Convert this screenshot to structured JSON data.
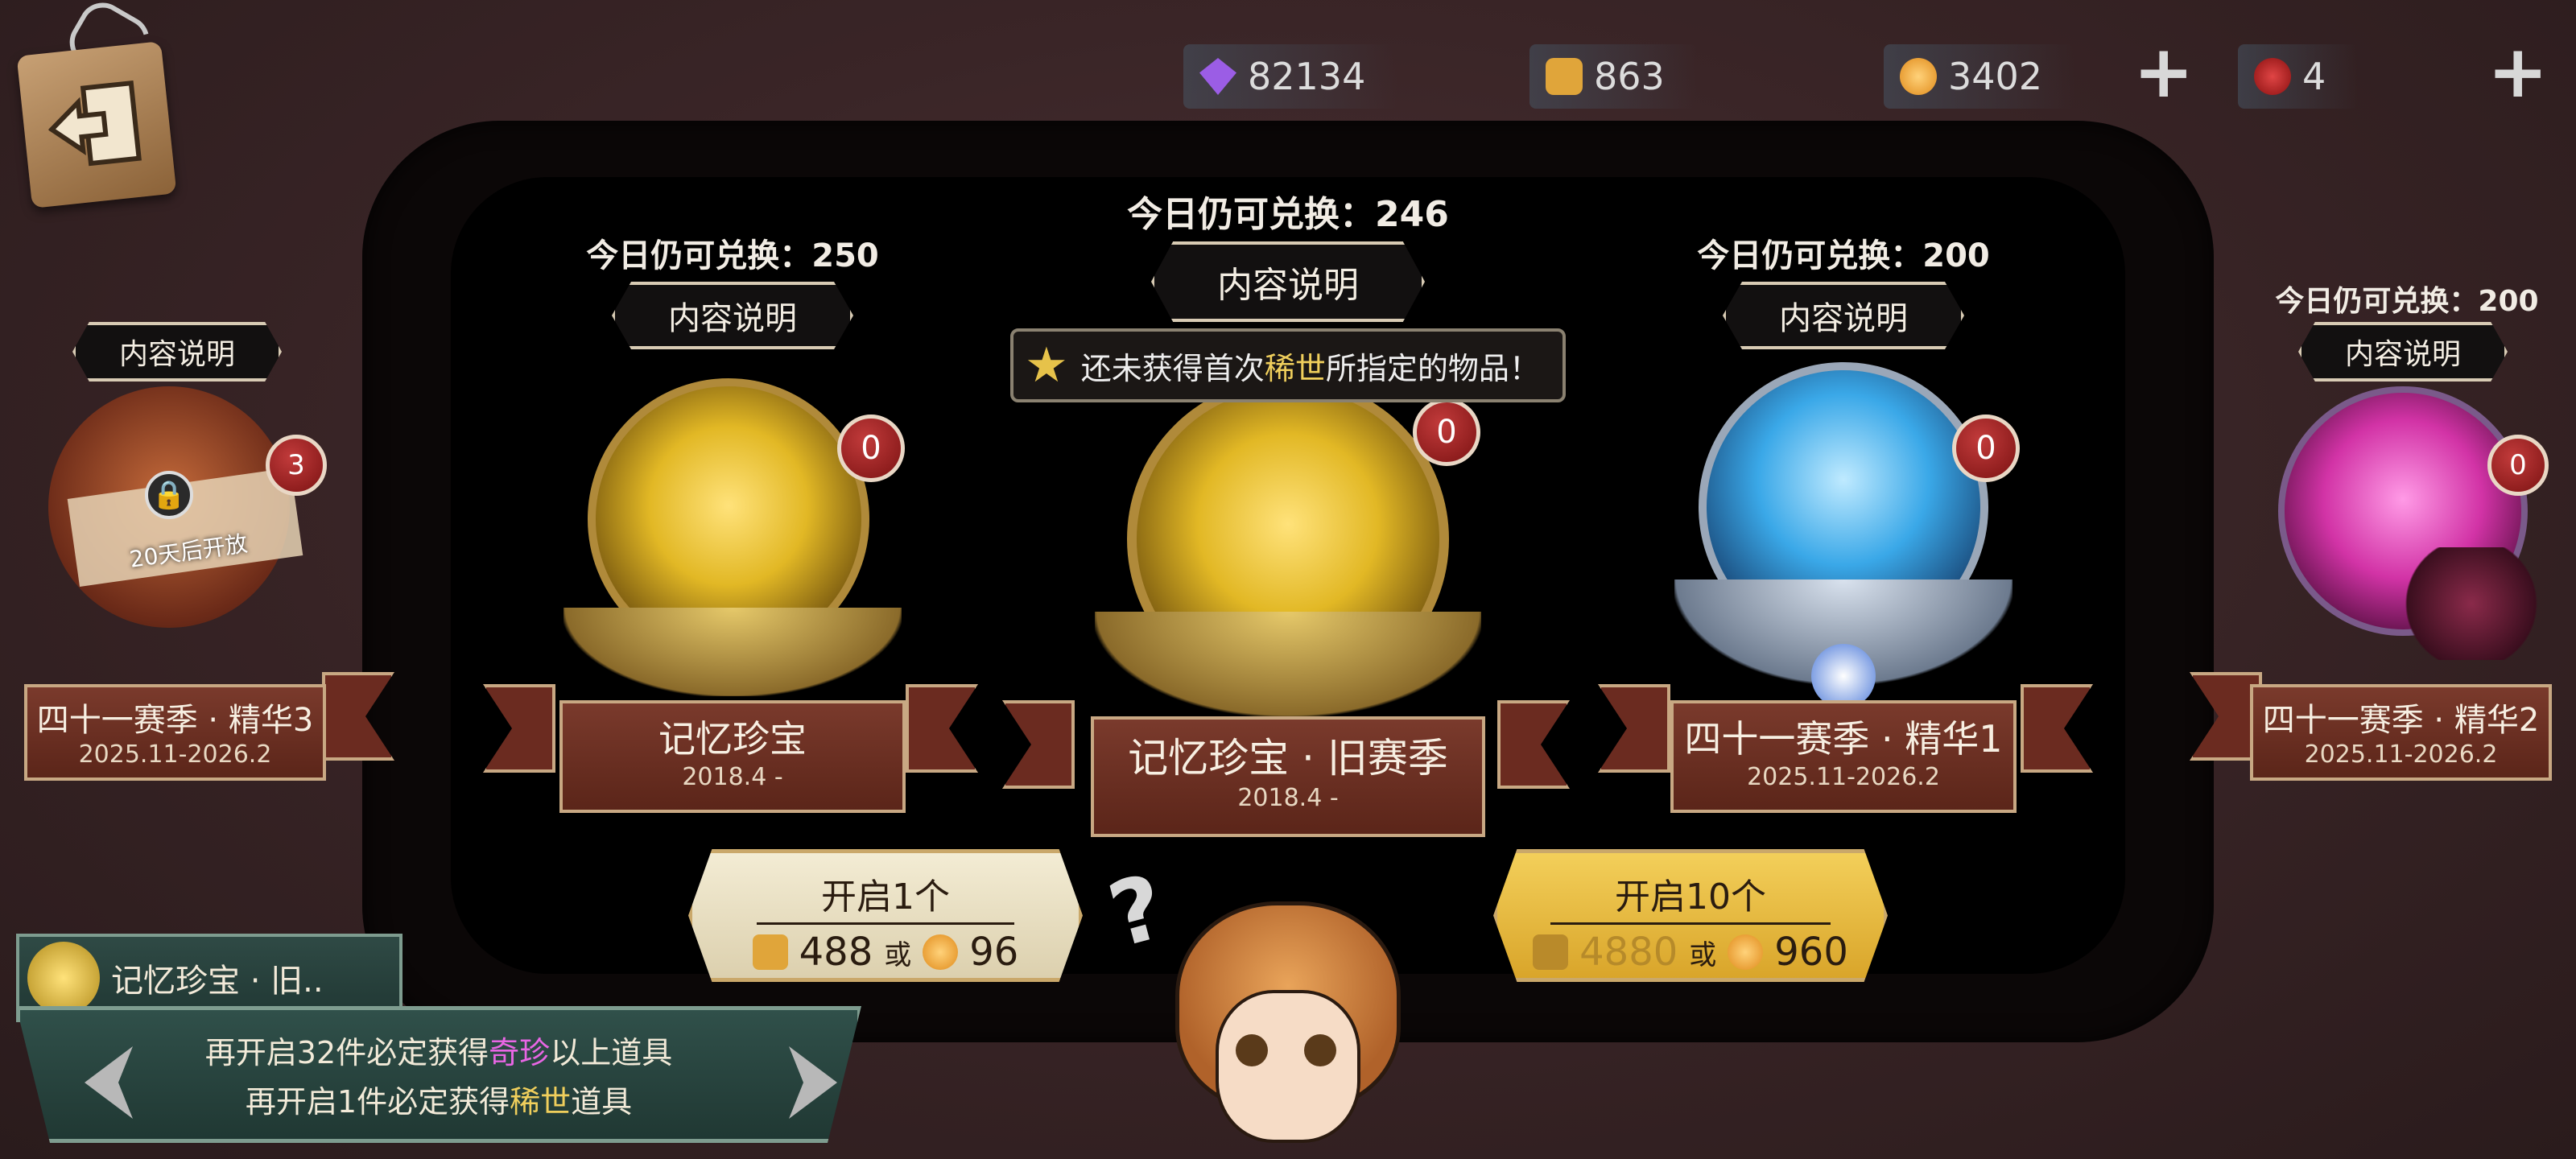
{
  "currencies": [
    {
      "icon": "purple-crystal-icon",
      "value": "82134",
      "color": "#9b5de5"
    },
    {
      "icon": "puzzle-piece-icon",
      "value": "863",
      "color": "#e0a53a"
    },
    {
      "icon": "clue-orb-icon",
      "value": "3402",
      "color": "#e59a2a"
    },
    {
      "icon": "red-seal-icon",
      "value": "4",
      "color": "#c0282a"
    }
  ],
  "add_label": "+",
  "cards": [
    {
      "key": "left-edge",
      "avail": "",
      "desc": "内容说明",
      "count": "3",
      "name": "四十一赛季 · 精华3",
      "date": "2025.11-2026.2",
      "lock_text": "20天后开放",
      "theme": "#b0532c"
    },
    {
      "key": "memory",
      "avail": "今日仍可兑换：250",
      "desc": "内容说明",
      "count": "0",
      "name": "记忆珍宝",
      "date": "2018.4 -",
      "theme": "#e2b825"
    },
    {
      "key": "memory-old",
      "avail": "今日仍可兑换：246",
      "desc": "内容说明",
      "count": "0",
      "name": "记忆珍宝 · 旧赛季",
      "date": "2018.4 -",
      "theme": "#e2b825"
    },
    {
      "key": "essence1",
      "avail": "今日仍可兑换：200",
      "desc": "内容说明",
      "count": "0",
      "name": "四十一赛季 · 精华1",
      "date": "2025.11-2026.2",
      "theme": "#3aa8e8"
    },
    {
      "key": "essence2",
      "avail": "今日仍可兑换：200",
      "desc": "内容说明",
      "count": "0",
      "name": "四十一赛季 · 精华2",
      "date": "2025.11-2026.2",
      "theme": "#d233a6"
    }
  ],
  "tooltip": {
    "prefix": "还未获得首次",
    "highlight": "稀世",
    "suffix": "所指定的物品！"
  },
  "open_one": {
    "label": "开启1个",
    "cost_a": "488",
    "or": "或",
    "cost_b": "96"
  },
  "open_ten": {
    "label": "开启10个",
    "cost_a": "4880",
    "or": "或",
    "cost_b": "960"
  },
  "info": {
    "title": "记忆珍宝 · 旧..",
    "line1_prefix": "再开启",
    "line1_num": "32",
    "line1_mid": "件必定获得",
    "line1_hl": "奇珍",
    "line1_suffix": "以上道具",
    "line2_prefix": "再开启",
    "line2_num": "1",
    "line2_mid": "件必定获得",
    "line2_hl": "稀世",
    "line2_suffix": "道具"
  },
  "help_icon": "question-mark-icon"
}
